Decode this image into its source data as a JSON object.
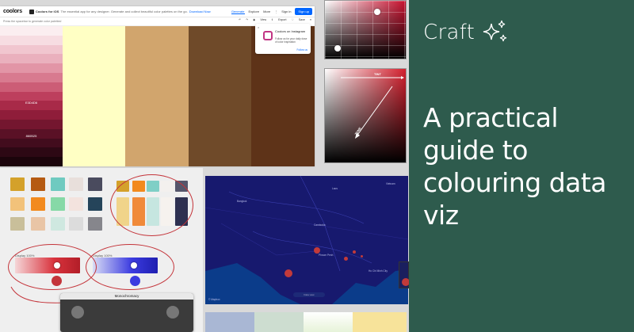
{
  "panel": {
    "brand": "Craft",
    "headline": "A practical guide to colouring data viz",
    "bg_color": "#2e5b4d",
    "icon": "sparkle-icon"
  },
  "coolors": {
    "logo": "coolors",
    "promo_title": "Coolors for iOS",
    "promo_text": "The essential app for any designer. Generate and collect beautiful color palettes on the go.",
    "promo_link": "Download Now",
    "nav": [
      "Generate",
      "Explore",
      "More"
    ],
    "signin": "Sign in",
    "signup": "Sign up",
    "hint": "Press the spacebar to generate color palettes!",
    "tools": [
      "View",
      "Export",
      "Save"
    ],
    "shade_labels": [
      "E3D4D6",
      "860B25"
    ],
    "swatch_colors": [
      "#ffffc4",
      "#d1a56d",
      "#6f4a29",
      "#5e3318"
    ],
    "instagram": {
      "title": "Coolors on Instagram",
      "body": "Follow us for your daily dose of color inspiration",
      "follow": "Follow us",
      "close": "×",
      "icon": "instagram-icon"
    }
  },
  "pickers": {
    "axis_top": "TINT",
    "axis_diag": "TONE"
  },
  "palettes": {
    "slider1_label": "Display 100%",
    "slider2_label": "Display 100%"
  },
  "mono_window": {
    "title": "Monochromacy"
  },
  "map": {
    "cities": [
      "Bangkok",
      "Cambodia",
      "Phnom Penh",
      "Ho Chi Minh City",
      "Vietnam",
      "Laos"
    ],
    "attribution": "© Mapbox",
    "button": "Data view"
  }
}
